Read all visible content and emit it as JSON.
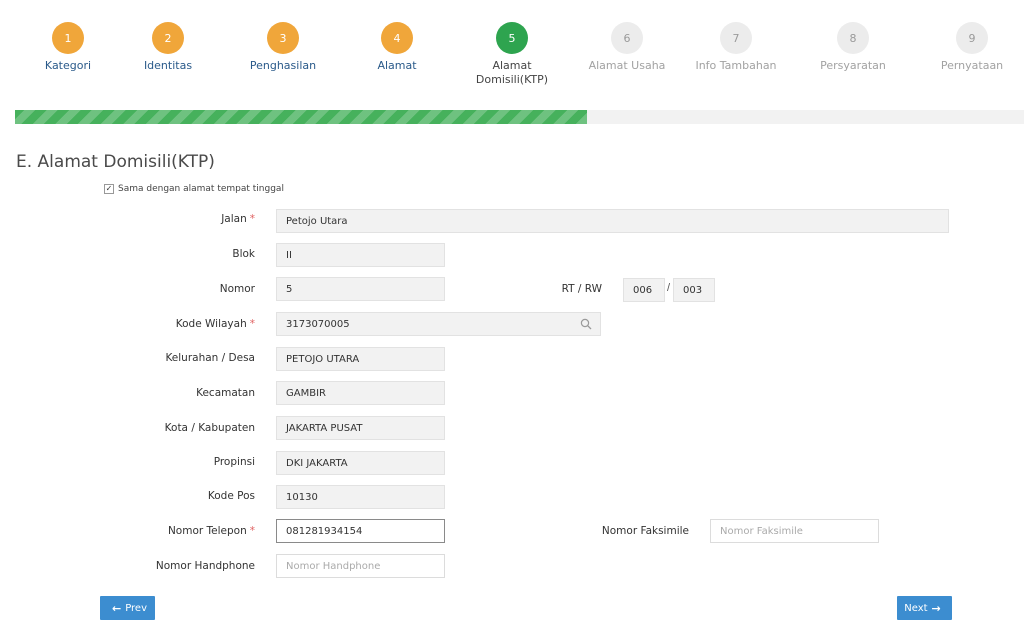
{
  "steps": [
    {
      "num": "1",
      "label": "Kategori"
    },
    {
      "num": "2",
      "label": "Identitas"
    },
    {
      "num": "3",
      "label": "Penghasilan"
    },
    {
      "num": "4",
      "label": "Alamat"
    },
    {
      "num": "5",
      "label_line1": "Alamat",
      "label_line2": "Domisili(KTP)"
    },
    {
      "num": "6",
      "label": "Alamat Usaha"
    },
    {
      "num": "7",
      "label": "Info Tambahan"
    },
    {
      "num": "8",
      "label": "Persyaratan"
    },
    {
      "num": "9",
      "label": "Pernyataan"
    }
  ],
  "progress": {
    "percent": 56.7
  },
  "colors": {
    "done": "#f0a63a",
    "active": "#2ea44f",
    "todo": "#ececec",
    "bar": "#46b15c",
    "button": "#3c8dd0"
  },
  "section_title": "E. Alamat Domisili(KTP)",
  "same_address": {
    "label": "Sama dengan alamat tempat tinggal",
    "checked": true
  },
  "form": {
    "jalan": {
      "label": "Jalan",
      "required": "*",
      "value": "Petojo Utara"
    },
    "blok": {
      "label": "Blok",
      "value": "II"
    },
    "nomor": {
      "label": "Nomor",
      "value": "5"
    },
    "rtrw": {
      "label": "RT / RW",
      "rt": "006",
      "separator": "/",
      "rw": "003"
    },
    "kode_wilayah": {
      "label": "Kode Wilayah",
      "required": "*",
      "value": "3173070005",
      "icon": "search-icon"
    },
    "kelurahan": {
      "label": "Kelurahan / Desa",
      "value": "PETOJO UTARA"
    },
    "kecamatan": {
      "label": "Kecamatan",
      "value": "GAMBIR"
    },
    "kota": {
      "label": "Kota / Kabupaten",
      "value": "JAKARTA PUSAT"
    },
    "propinsi": {
      "label": "Propinsi",
      "value": "DKI JAKARTA"
    },
    "kode_pos": {
      "label": "Kode Pos",
      "value": "10130"
    },
    "telepon": {
      "label": "Nomor Telepon",
      "required": "*",
      "value": "081281934154"
    },
    "faksimile": {
      "label": "Nomor Faksimile",
      "placeholder": "Nomor Faksimile"
    },
    "handphone": {
      "label": "Nomor Handphone",
      "placeholder": "Nomor Handphone"
    }
  },
  "buttons": {
    "prev": "Prev",
    "next": "Next"
  }
}
